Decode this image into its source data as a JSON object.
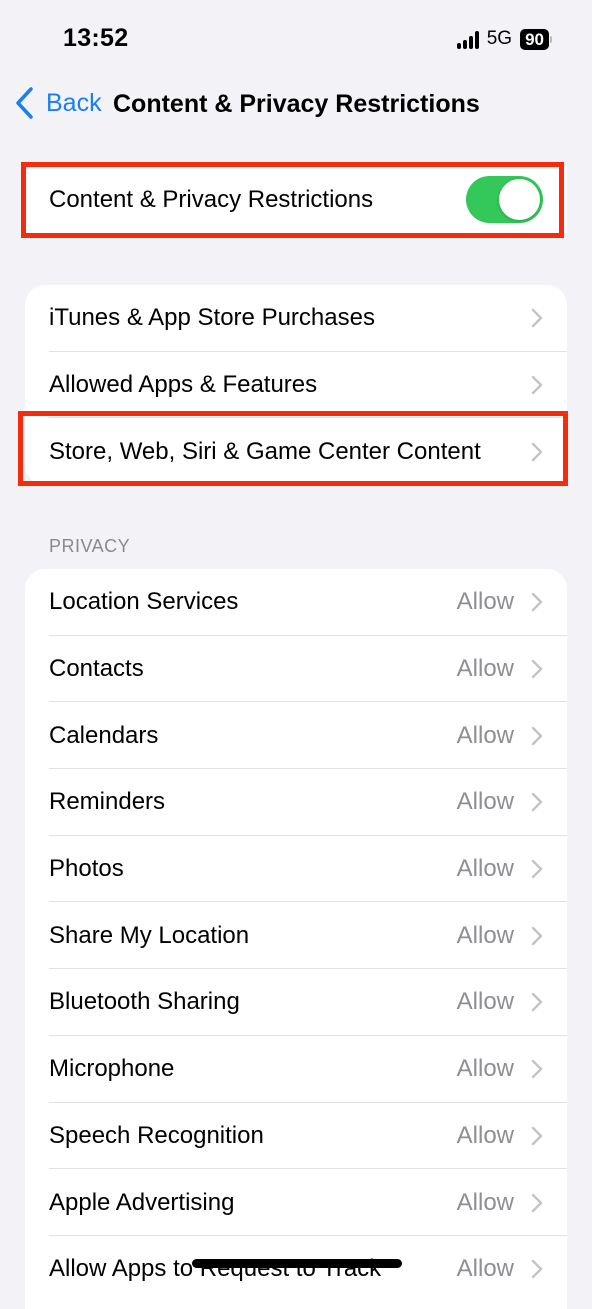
{
  "status_bar": {
    "time": "13:52",
    "network": "5G",
    "battery": "90",
    "icons": [
      "signal-icon",
      "battery-icon"
    ]
  },
  "nav": {
    "back_label": "Back",
    "title": "Content & Privacy Restrictions"
  },
  "master_toggle": {
    "label": "Content & Privacy Restrictions",
    "on": true,
    "color": "#34c759"
  },
  "content_group": {
    "items": [
      {
        "label": "iTunes & App Store Purchases"
      },
      {
        "label": "Allowed Apps & Features"
      },
      {
        "label": "Store, Web, Siri & Game Center Content"
      }
    ]
  },
  "privacy": {
    "header": "PRIVACY",
    "items": [
      {
        "label": "Location Services",
        "value": "Allow"
      },
      {
        "label": "Contacts",
        "value": "Allow"
      },
      {
        "label": "Calendars",
        "value": "Allow"
      },
      {
        "label": "Reminders",
        "value": "Allow"
      },
      {
        "label": "Photos",
        "value": "Allow"
      },
      {
        "label": "Share My Location",
        "value": "Allow"
      },
      {
        "label": "Bluetooth Sharing",
        "value": "Allow"
      },
      {
        "label": "Microphone",
        "value": "Allow"
      },
      {
        "label": "Speech Recognition",
        "value": "Allow"
      },
      {
        "label": "Apple Advertising",
        "value": "Allow"
      },
      {
        "label": "Allow Apps to Request to Track",
        "value": "Allow"
      }
    ]
  },
  "colors": {
    "accent": "#1a7ff0",
    "highlight": "#f42c0e",
    "background": "#f2f2f7"
  }
}
